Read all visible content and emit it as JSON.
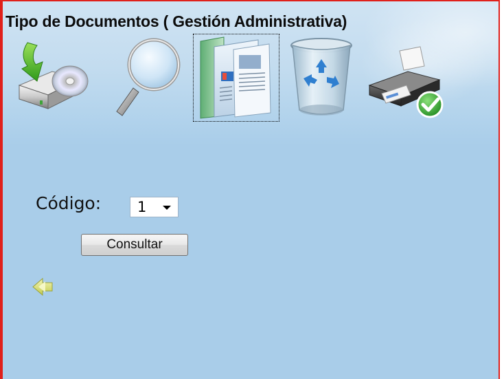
{
  "header": {
    "title": "Tipo de Documentos ( Gestión Administrativa)"
  },
  "toolbar": {
    "items": [
      {
        "icon": "save-disk-icon",
        "label": ""
      },
      {
        "icon": "search-magnifier-icon",
        "label": ""
      },
      {
        "icon": "documents-list-icon",
        "label": "",
        "selected": true
      },
      {
        "icon": "recycle-bin-icon",
        "label": ""
      },
      {
        "icon": "printer-check-icon",
        "label": ""
      }
    ]
  },
  "form": {
    "codigo_label": "Código:",
    "codigo_value": "1",
    "consultar_label": "Consultar"
  },
  "nav": {
    "back_icon": "double-left-arrow-icon"
  },
  "colors": {
    "frame_border": "#e0201b",
    "background": "#a9cde9"
  }
}
